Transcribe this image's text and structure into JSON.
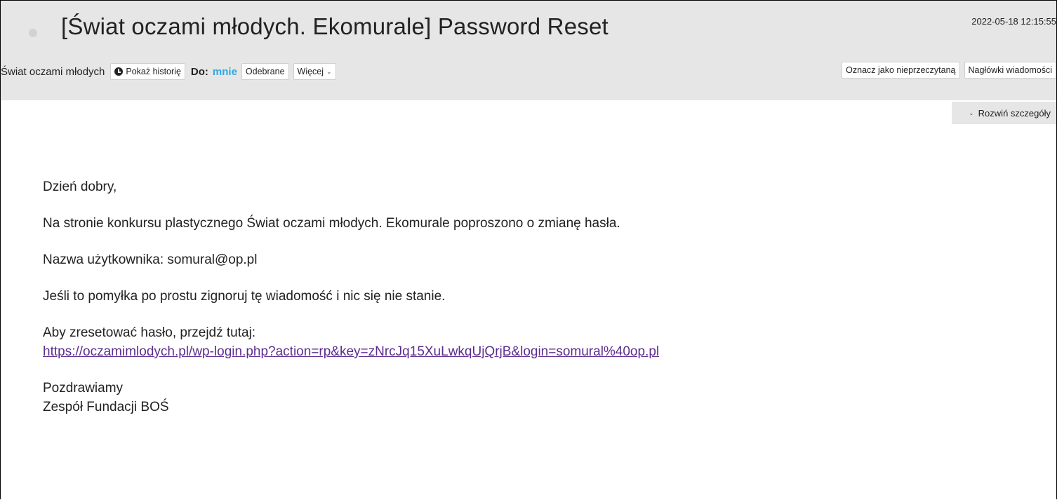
{
  "email": {
    "subject": "[Świat oczami młodych. Ekomurale] Password Reset",
    "date": "2022-05-18 12:15:55",
    "from_name": "Świat oczami młodych",
    "history_button": "Pokaż historię",
    "to_label": "Do:",
    "to_value": "mnie",
    "inbox_button": "Odebrane",
    "more_button": "Więcej",
    "mark_unread_button": "Oznacz jako nieprzeczytaną",
    "headers_button": "Nagłówki wiadomości",
    "expand_details": "Rozwiń szczegóły"
  },
  "body": {
    "greeting": "Dzień dobry,",
    "line1": "Na stronie konkursu plastycznego Świat oczami młodych. Ekomurale poproszono o zmianę hasła.",
    "line2": "Nazwa użytkownika: somural@op.pl",
    "line3": "Jeśli to pomyłka po prostu zignoruj tę wiadomość i nic się nie stanie.",
    "line4": "Aby zresetować hasło, przejdź tutaj:",
    "reset_link": "https://oczamimlodych.pl/wp-login.php?action=rp&key=zNrcJq15XuLwkqUjQrjB&login=somural%40op.pl",
    "closing": "Pozdrawiamy",
    "signature": "Zespół Fundacji BOŚ"
  },
  "icons": {
    "unread": "unread-dot-icon",
    "history": "clock-icon",
    "chevron": "chevron-down-icon"
  },
  "colors": {
    "header_bg": "#e6e6e6",
    "to_value": "#2fa8e0",
    "link": "#5c2d91"
  }
}
